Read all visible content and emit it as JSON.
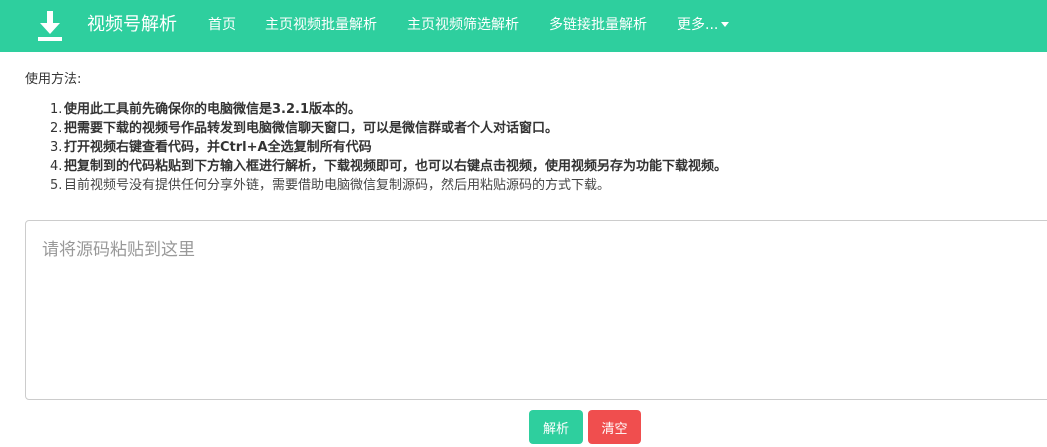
{
  "header": {
    "brand_icon": "download-icon",
    "brand_title": "视频号解析",
    "nav": [
      {
        "label": "首页"
      },
      {
        "label": "主页视频批量解析"
      },
      {
        "label": "主页视频筛选解析"
      },
      {
        "label": "多链接批量解析"
      },
      {
        "label": "更多..."
      }
    ]
  },
  "main": {
    "usage_label": "使用方法:",
    "steps": [
      {
        "num": "1.",
        "text": "使用此工具前先确保你的电脑微信是3.2.1版本的。"
      },
      {
        "num": "2.",
        "text": "把需要下载的视频号作品转发到电脑微信聊天窗口，可以是微信群或者个人对话窗口。"
      },
      {
        "num": "3.",
        "text": "打开视频右键查看代码，并Ctrl+A全选复制所有代码"
      },
      {
        "num": "4.",
        "text": "把复制到的代码粘贴到下方输入框进行解析，下载视频即可，也可以右键点击视频，使用视频另存为功能下载视频。"
      },
      {
        "num": "5.",
        "text": "目前视频号没有提供任何分享外链，需要借助电脑微信复制源码，然后用粘贴源码的方式下载。"
      }
    ],
    "source_input": {
      "value": "",
      "placeholder": "请将源码粘贴到这里"
    },
    "buttons": {
      "parse": "解析",
      "clear": "清空"
    }
  },
  "colors": {
    "accent": "#2ecf9e",
    "danger": "#f04e4e"
  }
}
